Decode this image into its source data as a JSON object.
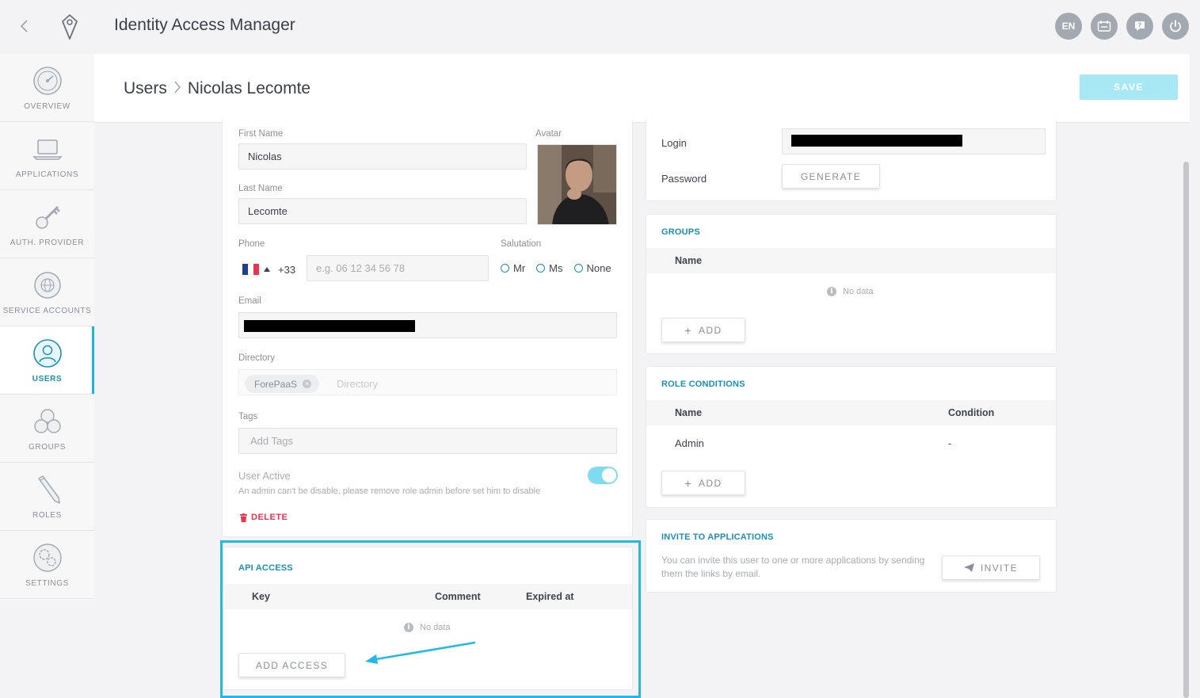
{
  "app": {
    "title": "Identity Access Manager"
  },
  "top_icons": {
    "language": "EN"
  },
  "sidebar": {
    "items": [
      {
        "label": "OVERVIEW",
        "icon": "gauge-icon"
      },
      {
        "label": "APPLICATIONS",
        "icon": "laptop-icon"
      },
      {
        "label": "AUTH. PROVIDER",
        "icon": "key-icon"
      },
      {
        "label": "SERVICE ACCOUNTS",
        "icon": "gear-globe-icon"
      },
      {
        "label": "USERS",
        "icon": "user-icon",
        "active": true
      },
      {
        "label": "GROUPS",
        "icon": "group-icon"
      },
      {
        "label": "ROLES",
        "icon": "pencil-icon"
      },
      {
        "label": "SETTINGS",
        "icon": "gears-icon"
      }
    ]
  },
  "header": {
    "breadcrumb_root": "Users",
    "breadcrumb_current": "Nicolas Lecomte",
    "save_label": "SAVE"
  },
  "profile": {
    "first_name_label": "First Name",
    "first_name_value": "Nicolas",
    "avatar_label": "Avatar",
    "last_name_label": "Last Name",
    "last_name_value": "Lecomte",
    "phone_label": "Phone",
    "phone_code": "+33",
    "phone_placeholder": "e.g. 06 12 34 56 78",
    "salutation_label": "Salutation",
    "salutation_options": [
      "Mr",
      "Ms",
      "None"
    ],
    "email_label": "Email",
    "directory_label": "Directory",
    "directory_chip": "ForePaaS",
    "directory_placeholder": "Directory",
    "tags_label": "Tags",
    "tags_placeholder": "Add Tags",
    "user_active_label": "User Active",
    "user_active_note": "An admin can't be disable, please remove role admin before set him to disable",
    "user_active_on": true,
    "delete_label": "DELETE"
  },
  "api_access": {
    "title": "API ACCESS",
    "columns": [
      "Key",
      "Comment",
      "Expired at"
    ],
    "no_data": "No data",
    "add_label": "ADD ACCESS"
  },
  "credentials": {
    "login_label": "Login",
    "password_label": "Password",
    "generate_label": "GENERATE"
  },
  "groups": {
    "title": "GROUPS",
    "column": "Name",
    "no_data": "No data",
    "add_label": "ADD"
  },
  "role_conditions": {
    "title": "ROLE CONDITIONS",
    "columns": [
      "Name",
      "Condition"
    ],
    "rows": [
      {
        "name": "Admin",
        "condition": "-"
      }
    ],
    "add_label": "ADD"
  },
  "invite": {
    "title": "INVITE TO APPLICATIONS",
    "text": "You can invite this user to one or more applications by sending them the links by email.",
    "button_label": "INVITE"
  },
  "colors": {
    "accent": "#1d8fb6",
    "highlight": "#22b8e8",
    "danger": "#e8344e",
    "save_disabled": "#a8e8f5"
  }
}
